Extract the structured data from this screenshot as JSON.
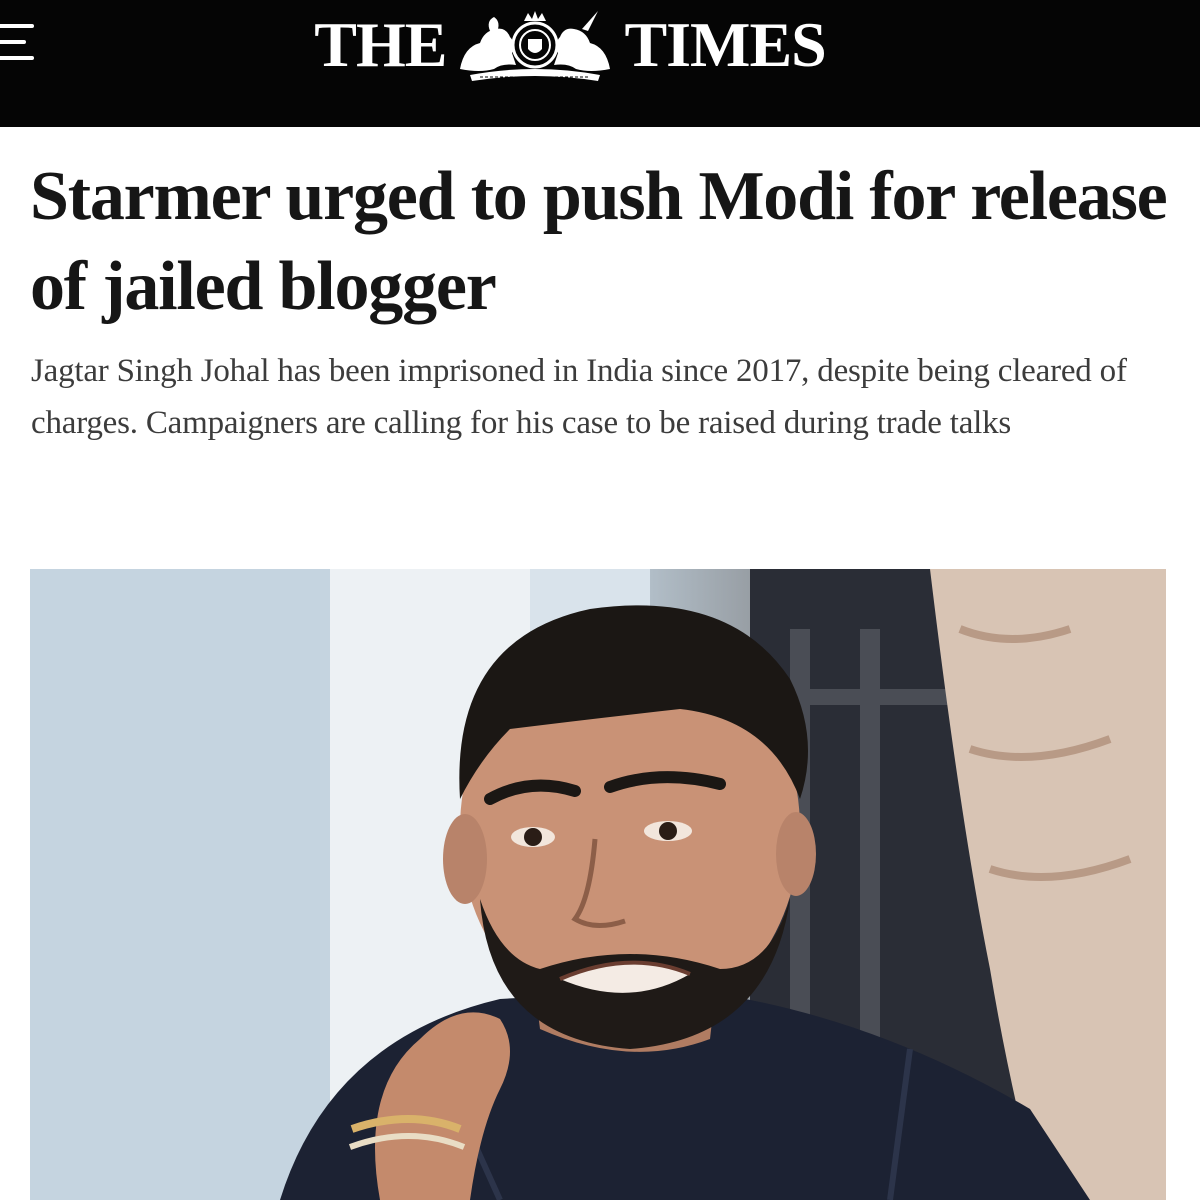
{
  "masthead": {
    "logo_left": "THE",
    "logo_right": "TIMES",
    "crest_icon": "royal-crest-icon",
    "menu_icon": "hamburger-menu-icon",
    "background": "#050505",
    "text_color": "#ffffff"
  },
  "article": {
    "headline": "Starmer urged to push Modi for release of jailed blogger",
    "standfirst": "Jagtar Singh Johal has been imprisoned in India since 2017, despite being cleared of charges. Campaigners are calling for his case to be raised during trade talks"
  },
  "colors": {
    "headline": "#161616",
    "standfirst": "#3c3c3c"
  }
}
